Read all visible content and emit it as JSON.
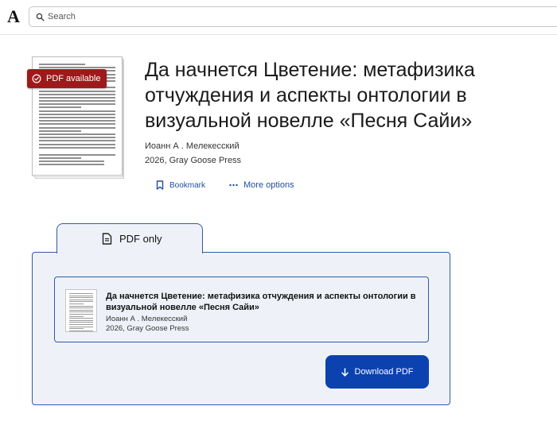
{
  "header": {
    "logo": "A",
    "search_placeholder": "Search"
  },
  "paper": {
    "badge": "PDF available",
    "title": "Да начнется Цветение: метафизика отчуждения и аспекты онтологии в визуальной новелле «Песня Сайи»",
    "author": "Иоанн А . Мелекесский",
    "pub_info": "2026, Gray Goose Press"
  },
  "actions": {
    "bookmark": "Bookmark",
    "more": "More options"
  },
  "tab": {
    "label": "PDF only"
  },
  "card": {
    "title": "Да начнется Цветение: метафизика отчуждения и аспекты онтологии в визуальной новелле «Песня Сайи»",
    "author": "Иоанн А . Мелекесский",
    "pub_info": "2026, Gray Goose Press"
  },
  "download": {
    "label": "Download PDF"
  },
  "colors": {
    "badge": "#9e1a1a",
    "accent": "#2f5aa8",
    "download": "#0b42b0",
    "panel_bg": "#eef2f8"
  },
  "icons": {
    "search": "search-icon",
    "badge": "check-circle-icon",
    "bookmark": "bookmark-icon",
    "more": "more-horizontal-icon",
    "tab": "document-icon",
    "download": "arrow-down-icon"
  }
}
